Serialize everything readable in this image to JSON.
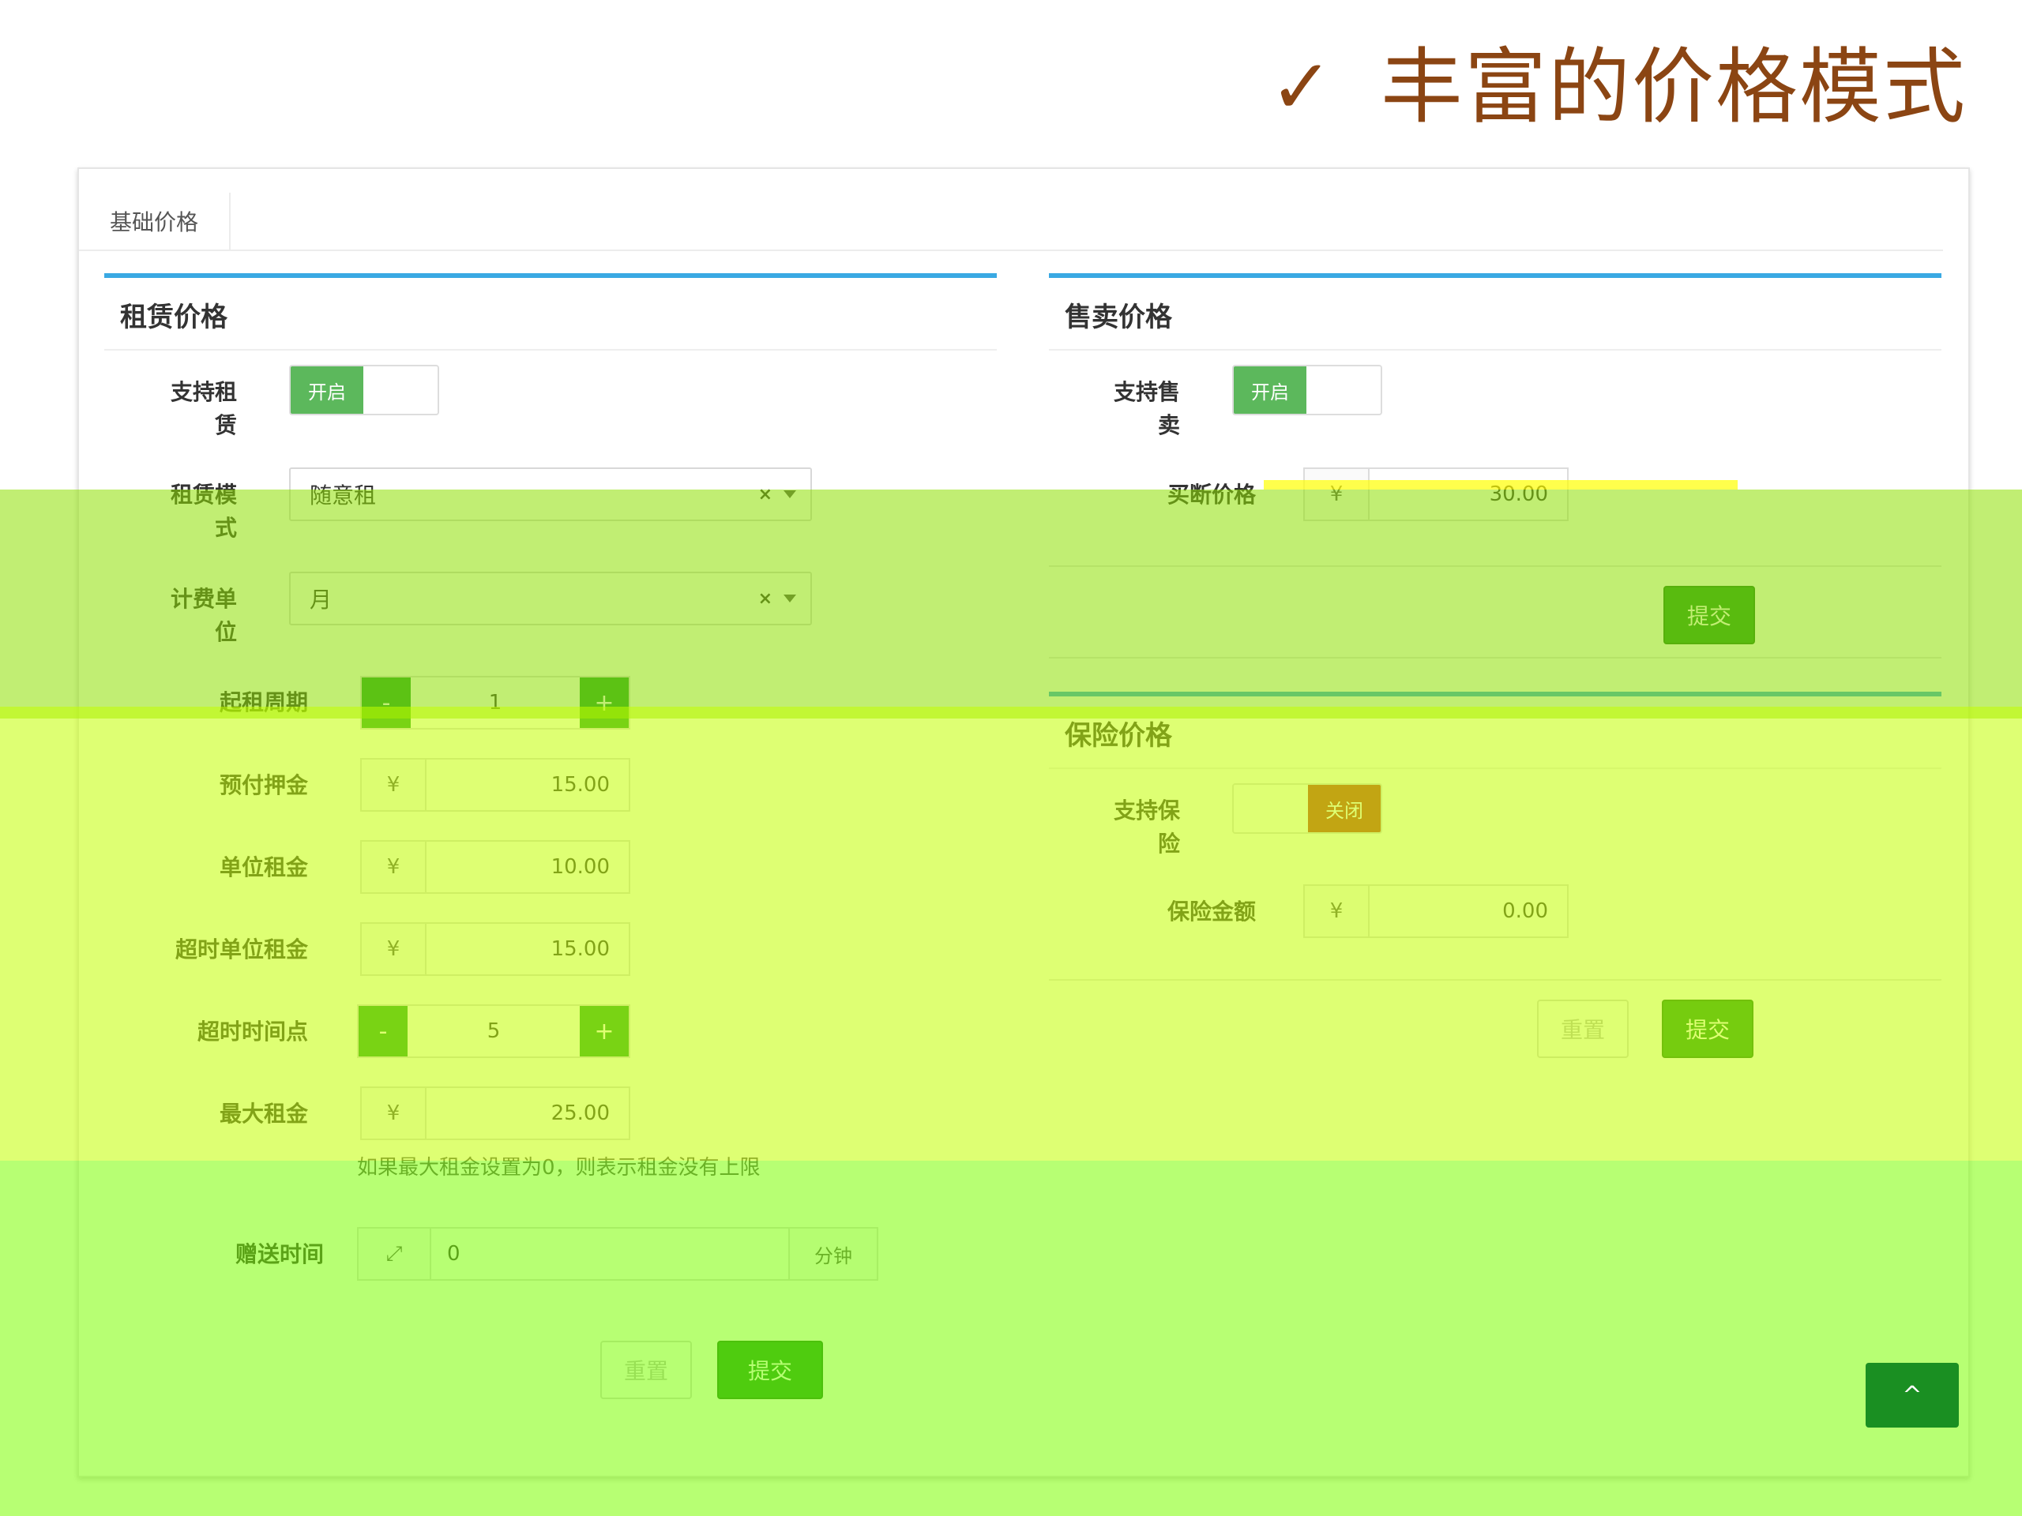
{
  "slide": {
    "check": "✓",
    "title": "丰富的价格模式"
  },
  "tabs": {
    "basic": "基础价格"
  },
  "rental": {
    "title": "租赁价格",
    "support_label_1": "支持租",
    "support_label_2": "赁",
    "support_state": "开启",
    "mode_label_1": "租赁模",
    "mode_label_2": "式",
    "mode_value": "随意租",
    "unit_label_1": "计费单",
    "unit_label_2": "位",
    "unit_value": "月",
    "min_period_label": "起租周期",
    "min_period_value": "1",
    "stepper_minus": "-",
    "stepper_plus": "+",
    "deposit_label": "预付押金",
    "deposit_currency": "¥",
    "deposit_value": "15.00",
    "unit_rent_label": "单位租金",
    "unit_rent_currency": "¥",
    "unit_rent_value": "10.00",
    "overtime_rent_label": "超时单位租金",
    "overtime_rent_currency": "¥",
    "overtime_rent_value": "15.00",
    "overtime_point_label": "超时时间点",
    "overtime_point_value": "5",
    "max_rent_label": "最大租金",
    "max_rent_currency": "¥",
    "max_rent_value": "25.00",
    "max_rent_hint": "如果最大租金设置为0，则表示租金没有上限",
    "free_time_label": "赠送时间",
    "free_time_value": "0",
    "free_time_suffix": "分钟",
    "reset_label": "重置",
    "submit_label": "提交"
  },
  "sale": {
    "title": "售卖价格",
    "support_label_1": "支持售",
    "support_label_2": "卖",
    "support_state": "开启",
    "buyout_label": "买断价格",
    "buyout_currency": "¥",
    "buyout_value": "30.00",
    "submit_label": "提交"
  },
  "insurance": {
    "title": "保险价格",
    "support_label_1": "支持保",
    "support_label_2": "险",
    "support_state": "关闭",
    "amount_label": "保险金额",
    "amount_currency": "¥",
    "amount_value": "0.00",
    "reset_label": "重置",
    "submit_label": "提交"
  },
  "back_to_top": "^"
}
